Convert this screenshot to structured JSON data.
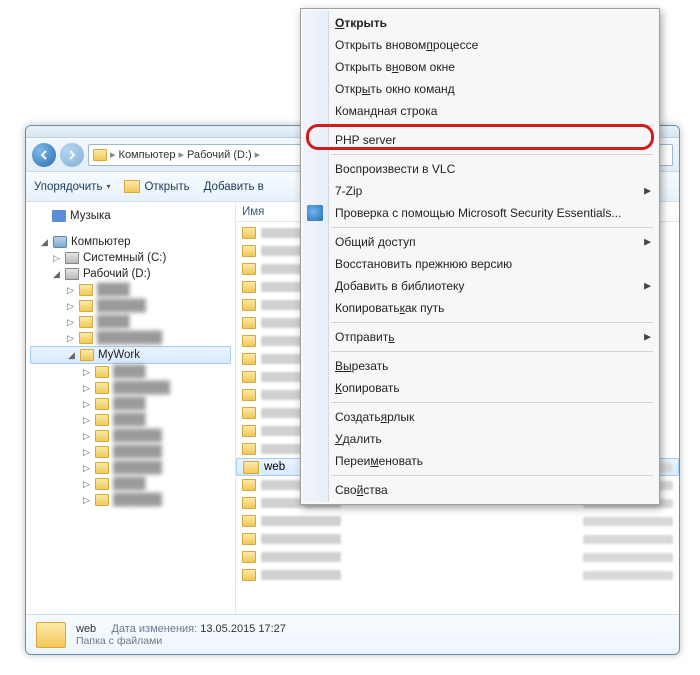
{
  "breadcrumb": {
    "item1": "Компьютер",
    "item2": "Рабочий (D:)"
  },
  "toolbar": {
    "organize": "Упорядочить",
    "open": "Открыть",
    "add": "Добавить в"
  },
  "tree": {
    "music": "Музыка",
    "computer": "Компьютер",
    "sysdrive": "Системный (C:)",
    "workdrive": "Рабочий (D:)",
    "mywork": "MyWork"
  },
  "listHeader": {
    "name": "Имя"
  },
  "selectedFolder": "web",
  "details": {
    "name": "web",
    "type": "Папка с файлами",
    "modLabel": "Дата изменения:",
    "modValue": "13.05.2015 17:27"
  },
  "menu": {
    "open": "ткрыть",
    "openNewProc1": "Открыть в ",
    "openNewProc2": "новом ",
    "openNewProc3": "роцессе",
    "openNewWin1": "Открыть в ",
    "openNewWin2": "овом окне",
    "cmdWindow1": "Откр",
    "cmdWindow2": "ть окно команд",
    "cmdline": "Командная строка",
    "php": "PHP server",
    "vlc": "Воспроизвести в VLC",
    "sevenzip": "7-Zip",
    "mse": "Проверка с помощью Microsoft Security Essentials...",
    "share": "Общий доступ",
    "restore": "Восстановить прежнюю версию",
    "library1": "обавить в библиотеку",
    "copypath1": "Копировать ",
    "copypath2": "ак путь",
    "sendto1": "Отправит",
    "cut1": "резать",
    "copy1": "опировать",
    "shortcut1": "Создать ",
    "shortcut2": "рлык",
    "delete1": "далить",
    "rename1": "Переи",
    "rename2": "еновать",
    "props1": "Сво",
    "props2": "ства"
  }
}
